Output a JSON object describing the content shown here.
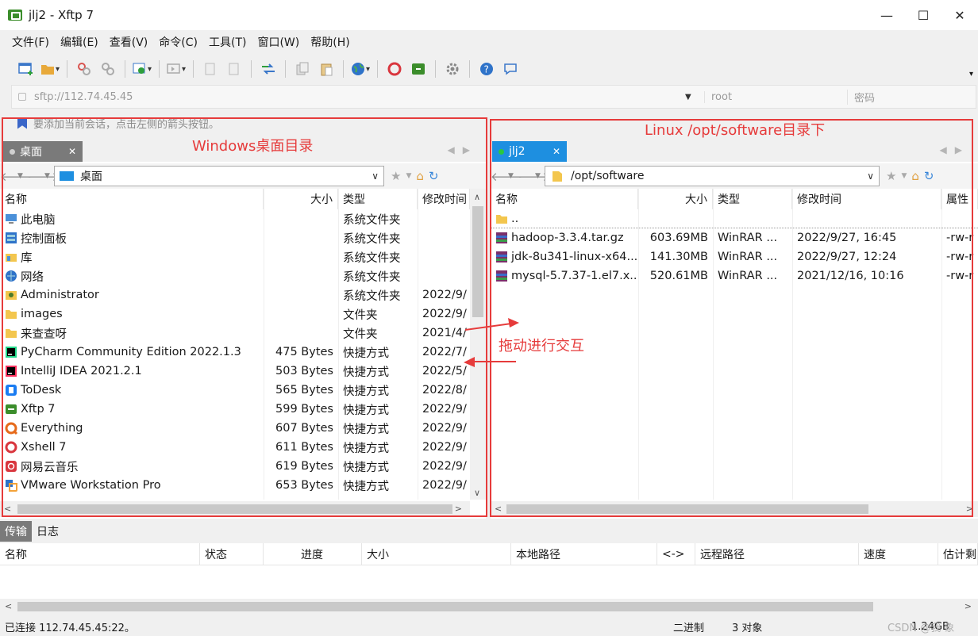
{
  "window": {
    "title": "jlj2 - Xftp 7",
    "minimize": "—",
    "maximize": "☐",
    "close": "✕"
  },
  "menu": [
    "文件(F)",
    "编辑(E)",
    "查看(V)",
    "命令(C)",
    "工具(T)",
    "窗口(W)",
    "帮助(H)"
  ],
  "address": {
    "url_placeholder": "sftp://112.74.45.45",
    "user_placeholder": "root",
    "password_placeholder": "密码"
  },
  "hint": "要添加当前会话，点击左侧的箭头按钮。",
  "left": {
    "tab_label": "桌面",
    "path": "桌面",
    "columns": [
      "名称",
      "大小",
      "类型",
      "修改时间"
    ],
    "rows": [
      {
        "name": "此电脑",
        "size": "",
        "type": "系统文件夹",
        "modified": "",
        "icon": "pc-icon"
      },
      {
        "name": "控制面板",
        "size": "",
        "type": "系统文件夹",
        "modified": "",
        "icon": "control-panel-icon"
      },
      {
        "name": "库",
        "size": "",
        "type": "系统文件夹",
        "modified": "",
        "icon": "library-icon"
      },
      {
        "name": "网络",
        "size": "",
        "type": "系统文件夹",
        "modified": "",
        "icon": "network-icon"
      },
      {
        "name": "Administrator",
        "size": "",
        "type": "系统文件夹",
        "modified": "2022/9/",
        "icon": "user-folder-icon"
      },
      {
        "name": "images",
        "size": "",
        "type": "文件夹",
        "modified": "2022/9/",
        "icon": "folder-icon"
      },
      {
        "name": "来查查呀",
        "size": "",
        "type": "文件夹",
        "modified": "2021/4/",
        "icon": "folder-icon"
      },
      {
        "name": "PyCharm Community Edition 2022.1.3",
        "size": "475 Bytes",
        "type": "快捷方式",
        "modified": "2022/7/",
        "icon": "pycharm-icon"
      },
      {
        "name": "IntelliJ IDEA 2021.2.1",
        "size": "503 Bytes",
        "type": "快捷方式",
        "modified": "2022/5/",
        "icon": "intellij-icon"
      },
      {
        "name": "ToDesk",
        "size": "565 Bytes",
        "type": "快捷方式",
        "modified": "2022/8/",
        "icon": "todesk-icon"
      },
      {
        "name": "Xftp 7",
        "size": "599 Bytes",
        "type": "快捷方式",
        "modified": "2022/9/",
        "icon": "xftp-icon"
      },
      {
        "name": "Everything",
        "size": "607 Bytes",
        "type": "快捷方式",
        "modified": "2022/9/",
        "icon": "everything-icon"
      },
      {
        "name": "Xshell 7",
        "size": "611 Bytes",
        "type": "快捷方式",
        "modified": "2022/9/",
        "icon": "xshell-icon"
      },
      {
        "name": "网易云音乐",
        "size": "619 Bytes",
        "type": "快捷方式",
        "modified": "2022/9/",
        "icon": "netease-music-icon"
      },
      {
        "name": "VMware Workstation Pro",
        "size": "653 Bytes",
        "type": "快捷方式",
        "modified": "2022/9/",
        "icon": "vmware-icon"
      }
    ]
  },
  "right": {
    "tab_label": "jlj2",
    "path": "/opt/software",
    "columns": [
      "名称",
      "大小",
      "类型",
      "修改时间",
      "属性"
    ],
    "rows": [
      {
        "name": "..",
        "size": "",
        "type": "",
        "modified": "",
        "attr": "",
        "icon": "folder-icon"
      },
      {
        "name": "hadoop-3.3.4.tar.gz",
        "size": "603.69MB",
        "type": "WinRAR ...",
        "modified": "2022/9/27, 16:45",
        "attr": "-rw-r",
        "icon": "winrar-icon"
      },
      {
        "name": "jdk-8u341-linux-x64...",
        "size": "141.30MB",
        "type": "WinRAR ...",
        "modified": "2022/9/27, 12:24",
        "attr": "-rw-r",
        "icon": "winrar-icon"
      },
      {
        "name": "mysql-5.7.37-1.el7.x...",
        "size": "520.61MB",
        "type": "WinRAR ...",
        "modified": "2021/12/16, 10:16",
        "attr": "-rw-r",
        "icon": "winrar-icon"
      }
    ]
  },
  "annotations": {
    "left_label": "Windows桌面目录",
    "right_label": "Linux /opt/software目录下",
    "drag_label": "拖动进行交互",
    "color": "#e63b3b"
  },
  "bottom": {
    "tabs": [
      "传输",
      "日志"
    ],
    "columns": [
      "名称",
      "状态",
      "进度",
      "大小",
      "本地路径",
      "<->",
      "远程路径",
      "速度",
      "估计剩"
    ]
  },
  "status": {
    "connection": "已连接 112.74.45.45:22。",
    "mode": "二进制",
    "objects": "3 对象",
    "size": "1.24GB",
    "watermark": "CSDN @我 象"
  }
}
